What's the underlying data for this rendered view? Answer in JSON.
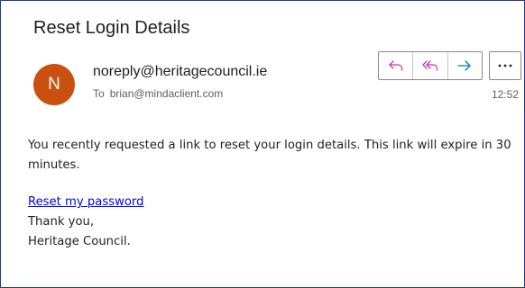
{
  "email": {
    "subject": "Reset Login Details",
    "sender": {
      "initial": "N",
      "address": "noreply@heritagecouncil.ie",
      "avatar_color": "#ca5010"
    },
    "recipient": {
      "label": "To",
      "address": "brian@mindaclient.com"
    },
    "time": "12:52",
    "actions": {
      "icons": [
        "reply-icon",
        "reply-all-icon",
        "forward-icon",
        "more-icon"
      ],
      "accent": "#c239b3",
      "forward_color": "#0078d4"
    },
    "body": {
      "paragraph": "You recently requested a link to reset your login details. This link will expire in 30 minutes.",
      "link_text": "Reset my password",
      "closing": "Thank you,",
      "signature": "Heritage Council."
    }
  }
}
